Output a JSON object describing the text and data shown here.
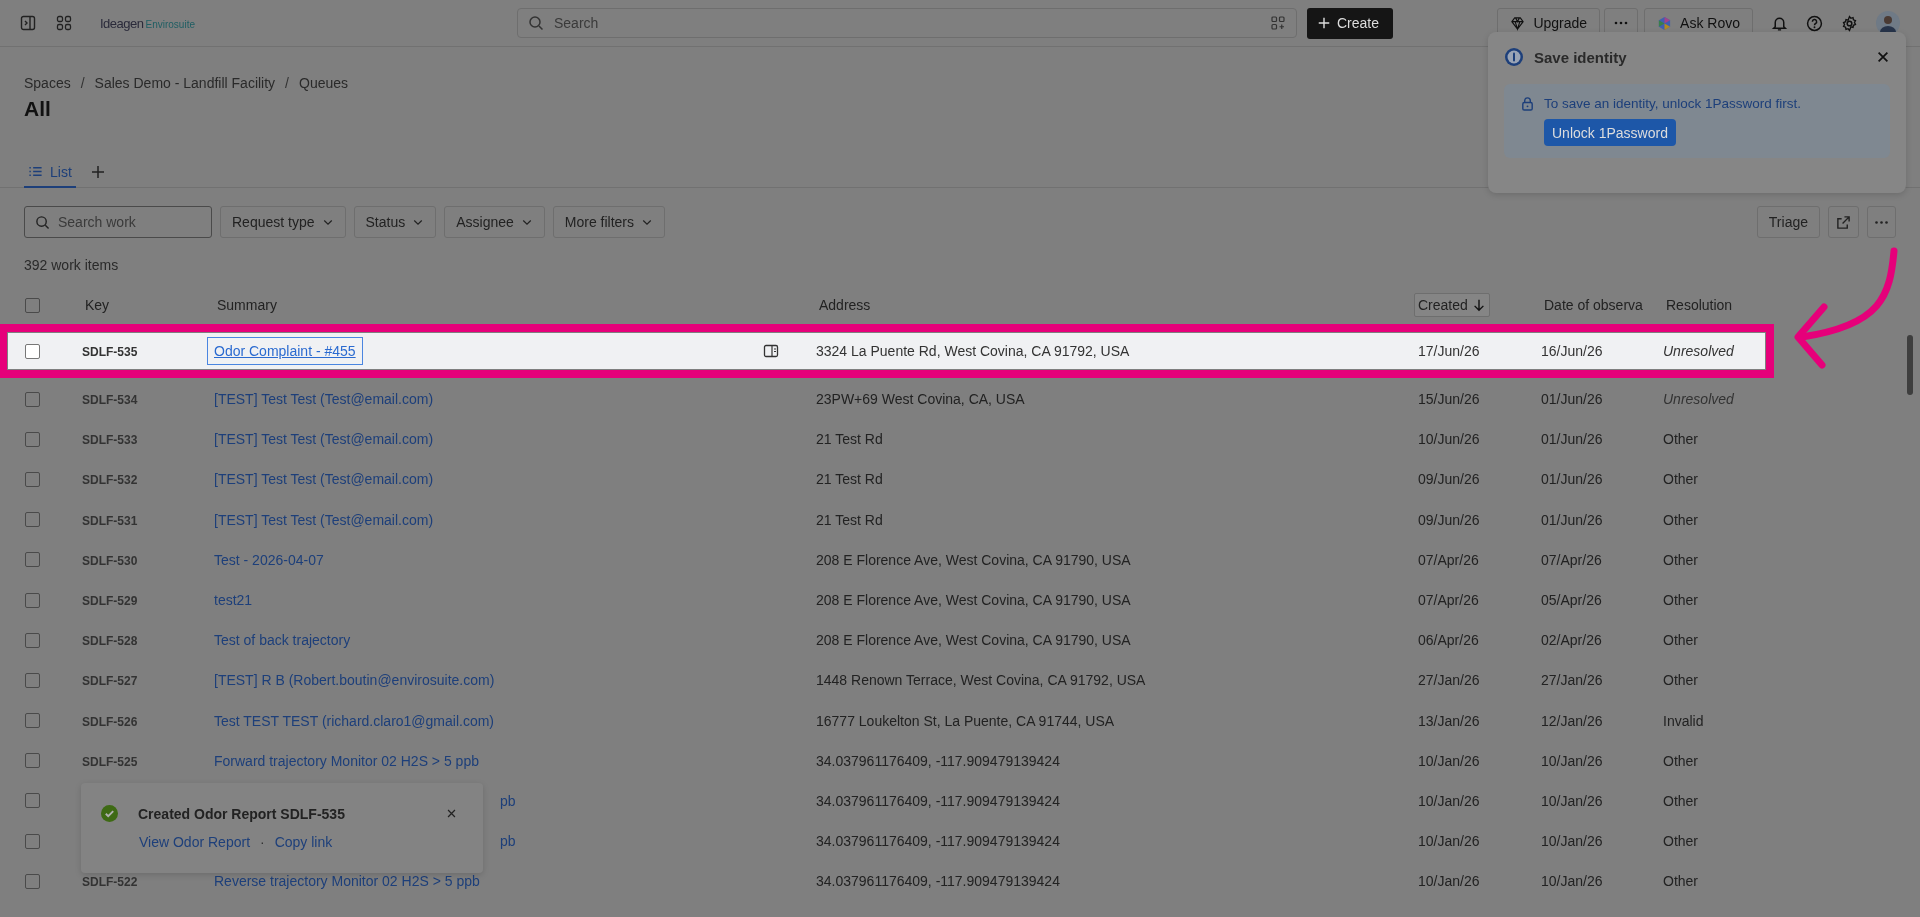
{
  "top_bar": {
    "logo": {
      "name": "Ideagen",
      "product": "Envirosuite"
    },
    "search": {
      "placeholder": "Search"
    },
    "create_button": "Create",
    "upgrade_button": "Upgrade",
    "ask_button": "Ask Rovo"
  },
  "breadcrumbs": [
    "Spaces",
    "Sales Demo - Landfill Facility",
    "Queues"
  ],
  "breadcrumb_separator": "/",
  "title": "All",
  "views": [
    {
      "label": "List",
      "selected": true
    }
  ],
  "filters": {
    "search": {
      "placeholder": "Search work"
    },
    "dropdowns": [
      "Request type",
      "Status",
      "Assignee",
      "More filters"
    ]
  },
  "actions": {
    "triage_button": "Triage"
  },
  "item_count": "392 work items",
  "table": {
    "all_checked": false,
    "columns": [
      {
        "label": "Key",
        "sorted": false
      },
      {
        "label": "Summary",
        "sorted": false
      },
      {
        "label": "Address",
        "sorted": false
      },
      {
        "label": "Created",
        "sorted": true
      },
      {
        "label": "Date of observa",
        "sorted": false
      },
      {
        "label": "Resolution",
        "sorted": false
      }
    ],
    "rows": [
      {
        "key": "SDLF-535",
        "summary": "Odor Complaint - #455",
        "address": "3324 La Puente Rd, West Covina, CA 91792, USA",
        "created": "17/Jun/26",
        "observed": "16/Jun/26",
        "resolution": "Unresolved",
        "resolved": false,
        "highlighted": true,
        "focused": true
      },
      {
        "key": "SDLF-534",
        "summary": "[TEST] Test Test (Test@email.com)",
        "address": "23PW+69 West Covina, CA, USA",
        "created": "15/Jun/26",
        "observed": "01/Jun/26",
        "resolution": "Unresolved",
        "resolved": false,
        "highlighted": false,
        "focused": false
      },
      {
        "key": "SDLF-533",
        "summary": "[TEST] Test Test (Test@email.com)",
        "address": "21 Test Rd",
        "created": "10/Jun/26",
        "observed": "01/Jun/26",
        "resolution": "Other",
        "resolved": true,
        "highlighted": false,
        "focused": false
      },
      {
        "key": "SDLF-532",
        "summary": "[TEST] Test Test (Test@email.com)",
        "address": "21 Test Rd",
        "created": "09/Jun/26",
        "observed": "01/Jun/26",
        "resolution": "Other",
        "resolved": true,
        "highlighted": false,
        "focused": false
      },
      {
        "key": "SDLF-531",
        "summary": "[TEST] Test Test (Test@email.com)",
        "address": "21 Test Rd",
        "created": "09/Jun/26",
        "observed": "01/Jun/26",
        "resolution": "Other",
        "resolved": true,
        "highlighted": false,
        "focused": false
      },
      {
        "key": "SDLF-530",
        "summary": "Test - 2026-04-07",
        "address": "208 E Florence Ave, West Covina, CA 91790, USA",
        "created": "07/Apr/26",
        "observed": "07/Apr/26",
        "resolution": "Other",
        "resolved": true,
        "highlighted": false,
        "focused": false
      },
      {
        "key": "SDLF-529",
        "summary": "test21",
        "address": "208 E Florence Ave, West Covina, CA 91790, USA",
        "created": "07/Apr/26",
        "observed": "05/Apr/26",
        "resolution": "Other",
        "resolved": true,
        "highlighted": false,
        "focused": false
      },
      {
        "key": "SDLF-528",
        "summary": "Test of back trajectory",
        "address": "208 E Florence Ave, West Covina, CA 91790, USA",
        "created": "06/Apr/26",
        "observed": "02/Apr/26",
        "resolution": "Other",
        "resolved": true,
        "highlighted": false,
        "focused": false
      },
      {
        "key": "SDLF-527",
        "summary": "[TEST] R B (Robert.boutin@envirosuite.com)",
        "address": "1448 Renown Terrace, West Covina, CA 91792, USA",
        "created": "27/Jan/26",
        "observed": "27/Jan/26",
        "resolution": "Other",
        "resolved": true,
        "highlighted": false,
        "focused": false
      },
      {
        "key": "SDLF-526",
        "summary": "Test TEST TEST (richard.claro1@gmail.com)",
        "address": "16777 Loukelton St, La Puente, CA 91744, USA",
        "created": "13/Jan/26",
        "observed": "12/Jan/26",
        "resolution": "Invalid",
        "resolved": true,
        "highlighted": false,
        "focused": false
      },
      {
        "key": "SDLF-525",
        "summary": "Forward trajectory Monitor 02 H2S > 5 ppb",
        "address": "34.037961176409, -117.909479139424",
        "created": "10/Jan/26",
        "observed": "10/Jan/26",
        "resolution": "Other",
        "resolved": true,
        "highlighted": false,
        "focused": false
      },
      {
        "summary": "pb",
        "address": "34.037961176409, -117.909479139424",
        "created": "10/Jan/26",
        "observed": "10/Jan/26",
        "resolution": "Other",
        "resolved": true,
        "highlighted": false,
        "focused": false
      },
      {
        "summary": "pb",
        "address": "34.037961176409, -117.909479139424",
        "created": "10/Jan/26",
        "observed": "10/Jan/26",
        "resolution": "Other",
        "resolved": true,
        "highlighted": false,
        "focused": false
      },
      {
        "key": "SDLF-522",
        "summary": "Reverse trajectory Monitor 02 H2S > 5 ppb",
        "address": "34.037961176409, -117.909479139424",
        "created": "10/Jan/26",
        "observed": "10/Jan/26",
        "resolution": "Other",
        "resolved": true,
        "highlighted": false,
        "focused": false
      }
    ]
  },
  "popup": {
    "title": "Save identity",
    "message": "To save an identity, unlock 1Password first.",
    "button": "Unlock 1Password"
  },
  "toast": {
    "message": "Created Odor Report SDLF-535",
    "links": [
      "View Odor Report",
      "Copy link"
    ],
    "separator": "·"
  }
}
